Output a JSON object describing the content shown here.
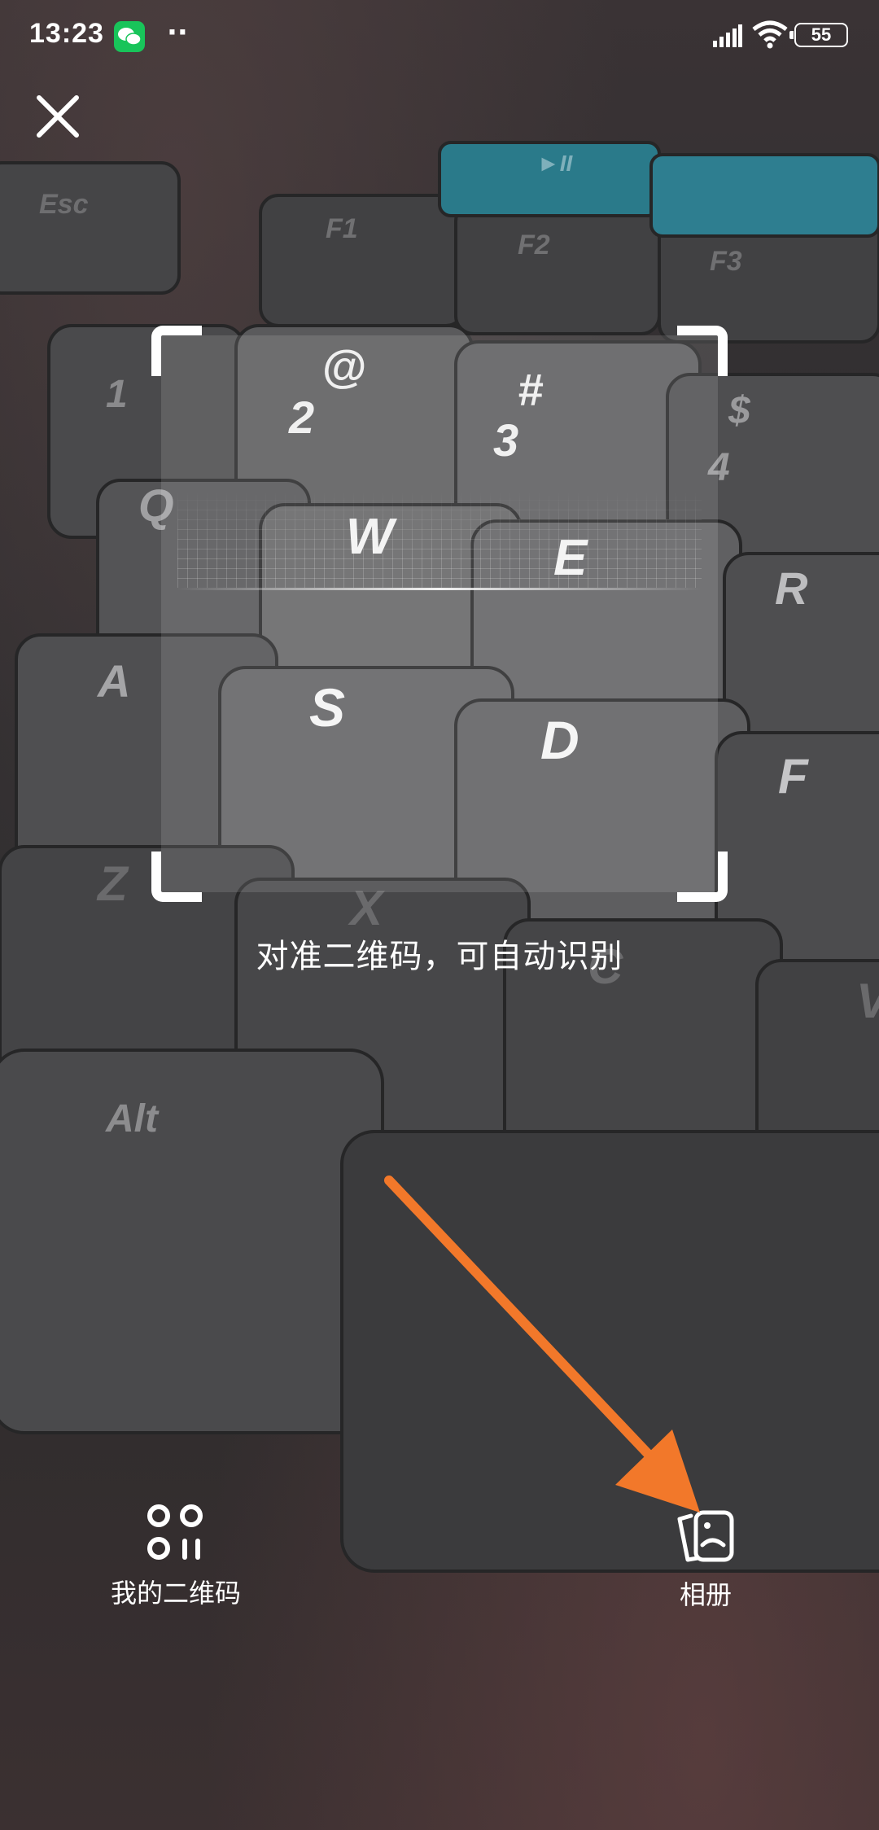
{
  "status_bar": {
    "time": "13:23",
    "app_icon": "wechat-icon",
    "dots": "··",
    "battery": "55"
  },
  "scanner": {
    "hint": "对准二维码，可自动识别"
  },
  "actions": {
    "my_qr_label": "我的二维码",
    "album_label": "相册"
  },
  "keyboard_keys": {
    "esc": "Esc",
    "f1": "F1",
    "f2": "F2",
    "f3": "F3",
    "play": "►II",
    "k1": "1",
    "at": "@",
    "k2": "2",
    "hash": "#",
    "k3": "3",
    "dollar": "$",
    "k4": "4",
    "q": "Q",
    "w": "W",
    "e": "E",
    "r": "R",
    "a": "A",
    "s": "S",
    "d": "D",
    "f": "F",
    "z": "Z",
    "x": "X",
    "c": "C",
    "v": "V",
    "alt": "Alt"
  },
  "colors": {
    "accent_arrow": "#f2782a",
    "wechat_green": "#18c45a",
    "teal_key": "#2a7a8a"
  }
}
